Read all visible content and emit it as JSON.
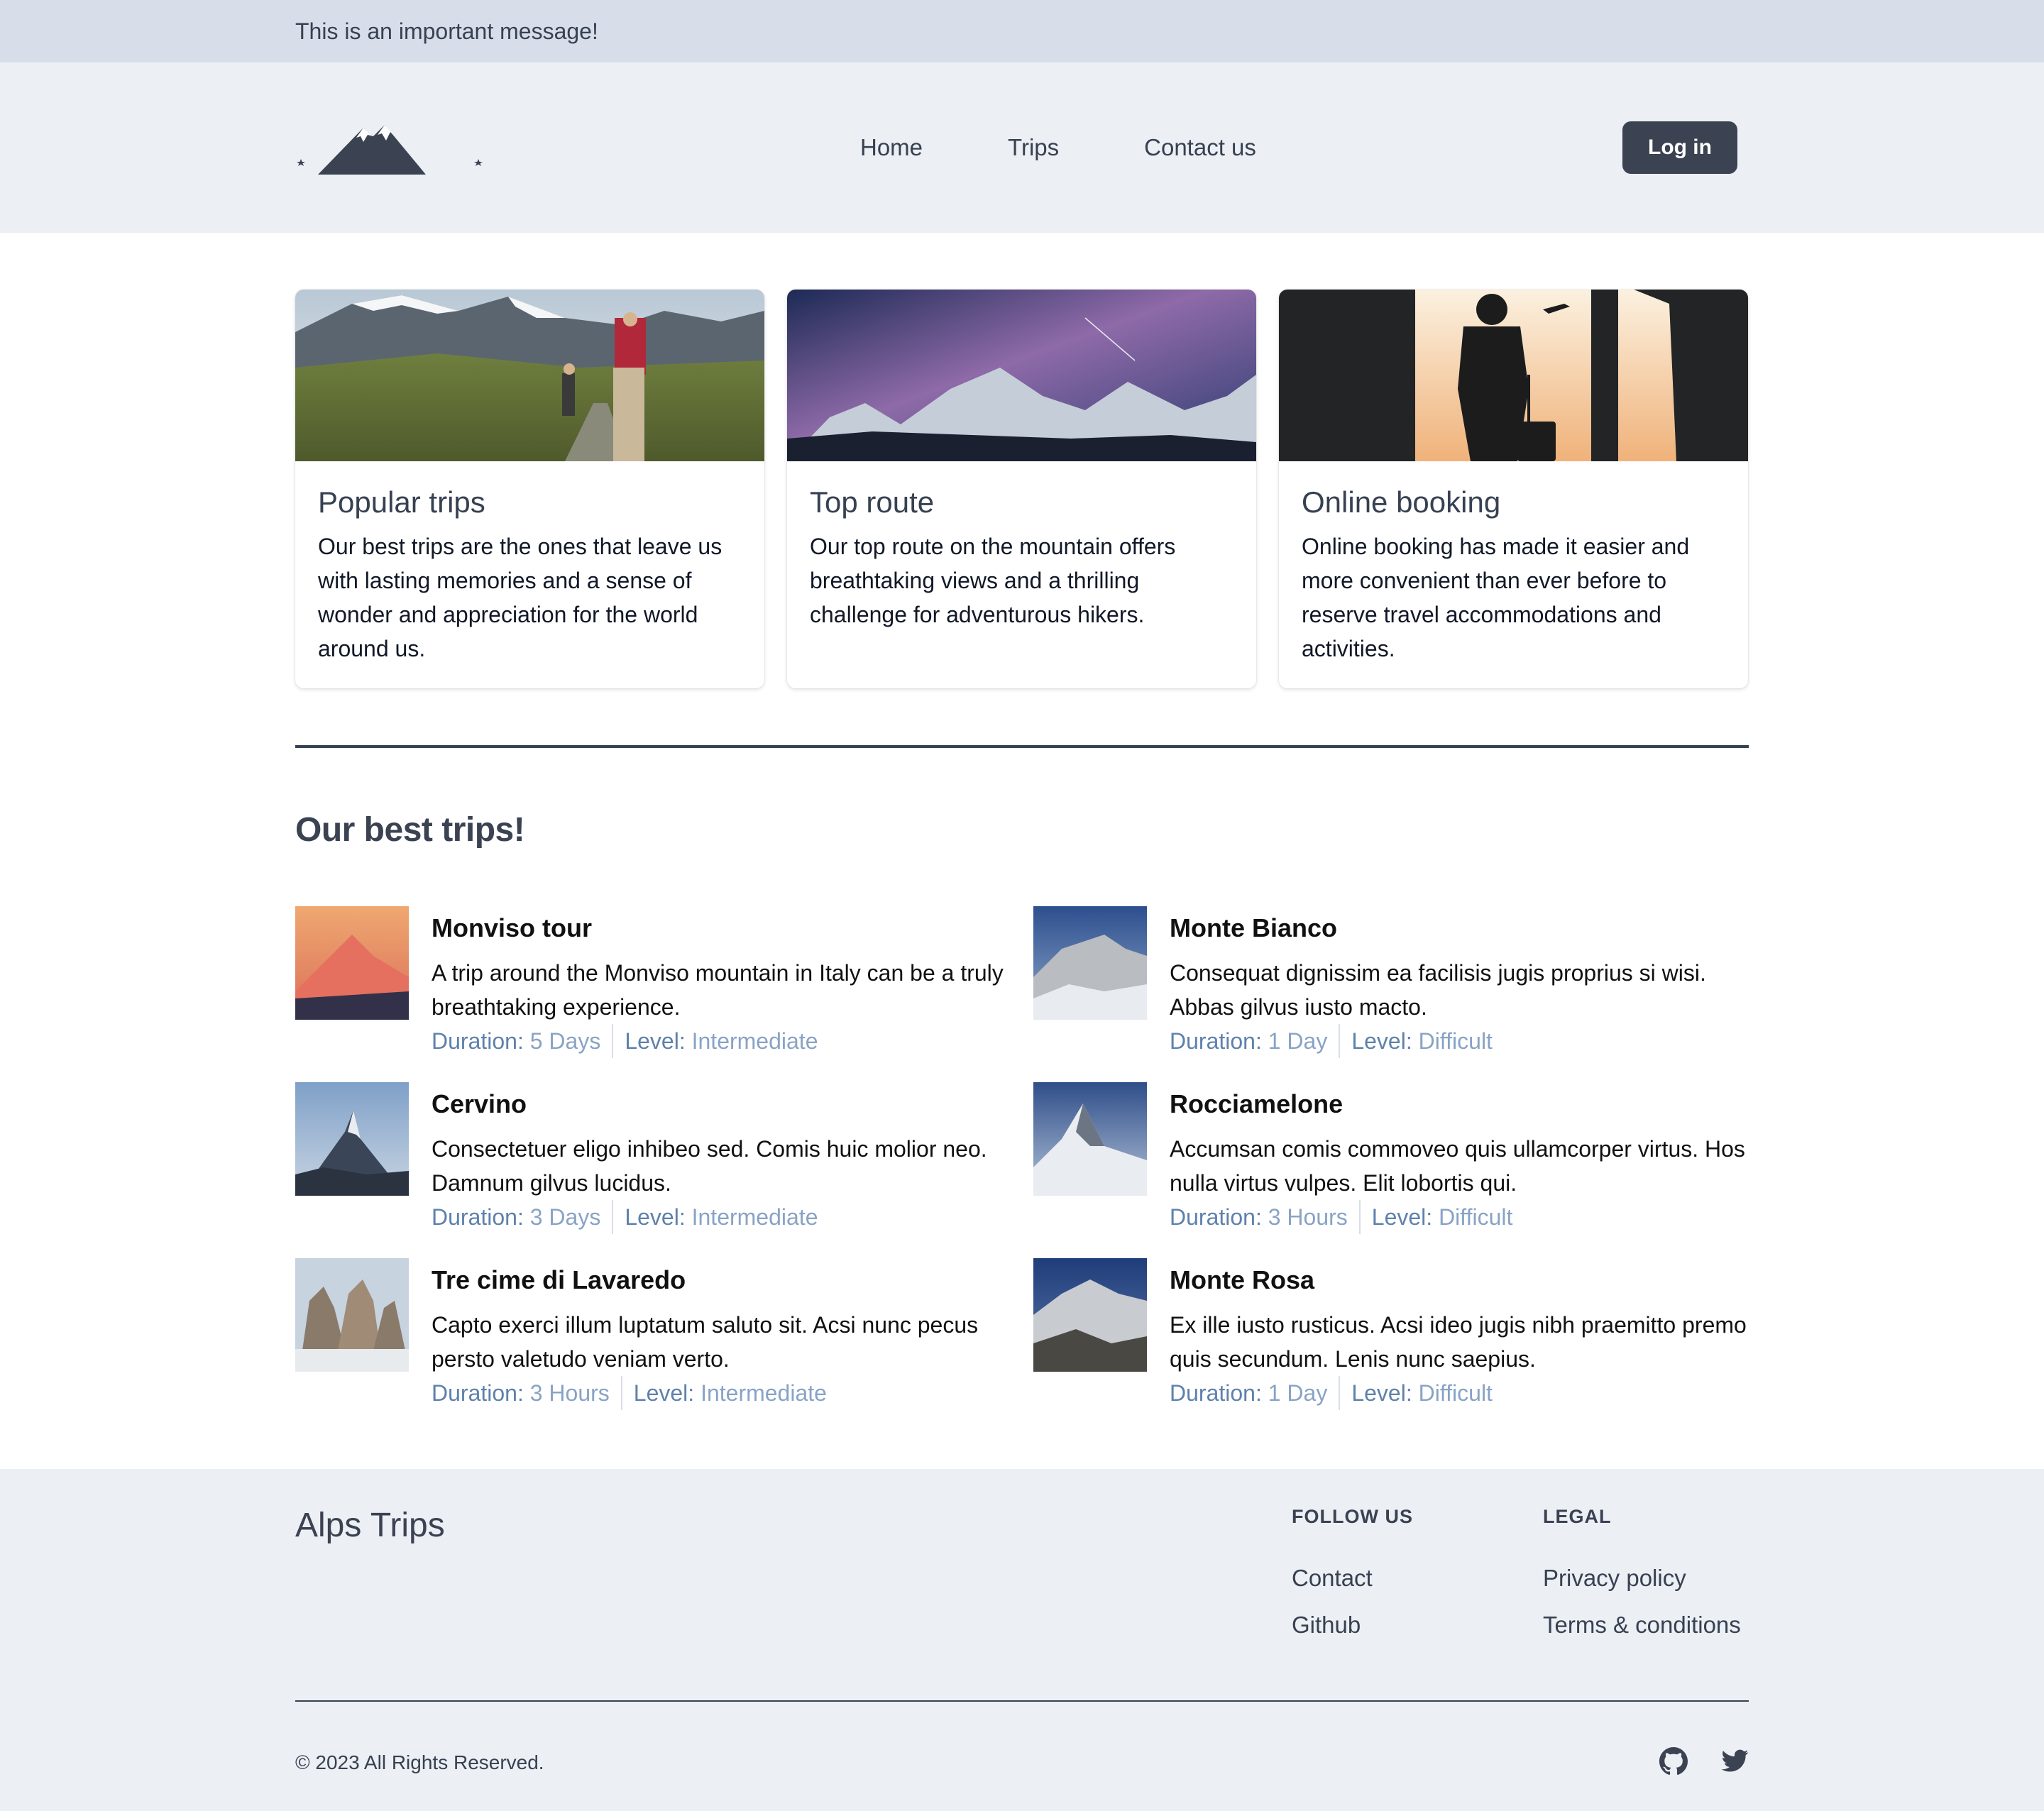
{
  "banner": {
    "text": "This is an important message!"
  },
  "header": {
    "nav": [
      "Home",
      "Trips",
      "Contact us"
    ],
    "login_label": "Log in"
  },
  "features": [
    {
      "title": "Popular trips",
      "text": "Our best trips are the ones that leave us with lasting memories and a sense of wonder and appreciation for the world around us."
    },
    {
      "title": "Top route",
      "text": "Our top route on the mountain offers breathtaking views and a thrilling challenge for adventurous hikers."
    },
    {
      "title": "Online booking",
      "text": "Online booking has made it easier and more convenient than ever before to reserve travel accommodations and activities."
    }
  ],
  "best_trips": {
    "title": "Our best trips!",
    "duration_label": "Duration:",
    "level_label": "Level:",
    "items": [
      {
        "name": "Monviso tour",
        "desc": "A trip around the Monviso mountain in Italy can be a truly breathtaking experience.",
        "duration": "5 Days",
        "level": "Intermediate"
      },
      {
        "name": "Monte Bianco",
        "desc": "Consequat dignissim ea facilisis jugis proprius si wisi. Abbas gilvus iusto macto.",
        "duration": "1 Day",
        "level": "Difficult"
      },
      {
        "name": "Cervino",
        "desc": "Consectetuer eligo inhibeo sed. Comis huic molior neo. Damnum gilvus lucidus.",
        "duration": "3 Days",
        "level": "Intermediate"
      },
      {
        "name": "Rocciamelone",
        "desc": "Accumsan comis commoveo quis ullamcorper virtus. Hos nulla virtus vulpes. Elit lobortis qui.",
        "duration": "3 Hours",
        "level": "Difficult"
      },
      {
        "name": "Tre cime di Lavaredo",
        "desc": "Capto exerci illum luptatum saluto sit. Acsi nunc pecus persto valetudo veniam verto.",
        "duration": "3 Hours",
        "level": "Intermediate"
      },
      {
        "name": "Monte Rosa",
        "desc": "Ex ille iusto rusticus. Acsi ideo jugis nibh praemitto premo quis secundum. Lenis nunc saepius.",
        "duration": "1 Day",
        "level": "Difficult"
      }
    ]
  },
  "footer": {
    "brand": "Alps Trips",
    "follow": {
      "heading": "FOLLOW US",
      "links": [
        "Contact",
        "Github"
      ]
    },
    "legal": {
      "heading": "LEGAL",
      "links": [
        "Privacy policy",
        "Terms & conditions"
      ]
    },
    "copyright": "© 2023 All Rights Reserved.",
    "social_icons": [
      "github-icon",
      "twitter-icon"
    ]
  }
}
